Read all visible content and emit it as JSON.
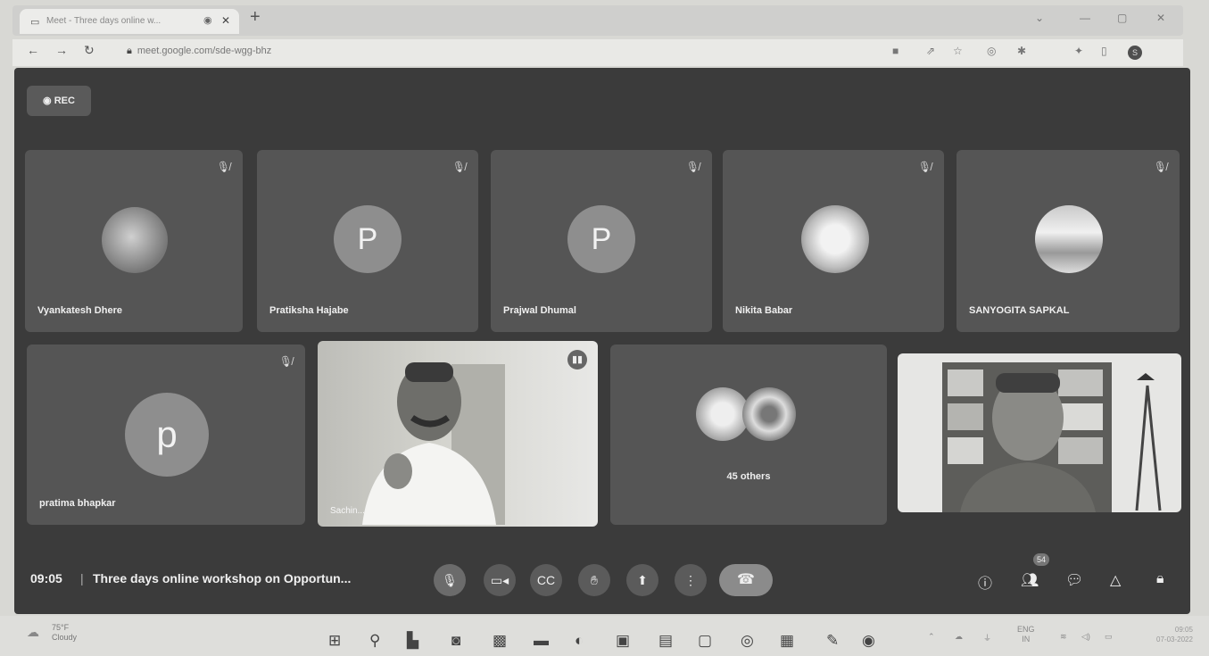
{
  "browser": {
    "tab_title": "Meet - Three days online w...",
    "url": "meet.google.com/sde-wgg-bhz",
    "icons": [
      "back-arrow",
      "forward-arrow",
      "reload",
      "lock",
      "extension",
      "share",
      "star",
      "profile"
    ]
  },
  "meet": {
    "rec_label": "REC",
    "participants_row1": [
      {
        "name": "Vyankatesh Dhere",
        "avatar": "photo"
      },
      {
        "name": "Pratiksha Hajabe",
        "avatar": "P"
      },
      {
        "name": "Prajwal Dhumal",
        "avatar": "P"
      },
      {
        "name": "Nikita Babar",
        "avatar": "photo"
      },
      {
        "name": "SANYOGITA SAPKAL",
        "avatar": "photo"
      }
    ],
    "participants_row2": [
      {
        "name": "pratima bhapkar",
        "avatar": "p"
      }
    ],
    "speaker_label": "Sachin...",
    "others_label": "45 others",
    "time": "09:05",
    "meeting_title": "Three days online workshop on Opportun...",
    "people_count": "54"
  },
  "taskbar": {
    "weather_temp": "75°F",
    "weather_desc": "Cloudy",
    "lang_top": "ENG",
    "lang_bottom": "IN",
    "clock_time": "09:05",
    "clock_date": "07-03-2022"
  },
  "colors": {
    "meet_bg": "#3b3b3b",
    "tile_bg": "#555555",
    "avatar_gray": "#8e8e8e"
  }
}
